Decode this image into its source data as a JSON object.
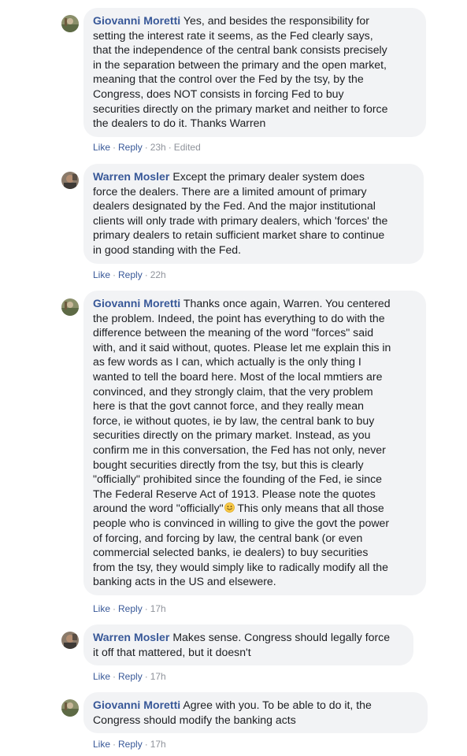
{
  "colors": {
    "author": "#385898",
    "bubble_bg": "#f2f3f5",
    "text": "#1c1e21",
    "meta": "#90949c"
  },
  "comments": [
    {
      "author": "Giovanni Moretti",
      "text": "Yes, and besides the responsibility for\nsetting the interest rate it seems, as the Fed clearly says,\nthat the independence of the central bank consists precisely\nin the separation between the primary and the open market,\nmeaning that the control over the Fed by the tsy, by the\nCongress, does NOT consists in forcing Fed to buy\nsecurities directly on the primary market and neither to force\nthe dealers to do it. Thanks Warren",
      "like": "Like",
      "reply": "Reply",
      "time": "23h",
      "edited": "Edited"
    },
    {
      "author": "Warren Mosler",
      "text": "Except the primary dealer system does\nforce the dealers. There are a limited amount of primary\ndealers designated by the Fed. And the major institutional\nclients will only trade with primary dealers, which 'forces' the\nprimary dealers to retain sufficient market share to continue\nin good standing with the Fed.",
      "like": "Like",
      "reply": "Reply",
      "time": "22h"
    },
    {
      "author": "Giovanni Moretti",
      "text": "Thanks once again, Warren. You centered\nthe problem. Indeed, the point has everything to do with the\ndifference between the meaning of the word \"forces\" said\nwith, and it said without, quotes. Please let me explain this in\nas few words as I can, which actually is the only thing I\nwanted to tell the board here. Most of the local mmtiers are\nconvinced, and they strongly claim, that the very problem\nhere is that the govt cannot force, and they really mean\nforce, ie without quotes, ie by law, the central bank to buy\nsecurities directly on the primary market. Instead, as you\nconfirm me in this conversation, the Fed has not only, never\nbought securities directly from the tsy, but this is clearly\n\"officially\" prohibited since the founding of the Fed, ie since\nThe Federal Reserve Act of 1913. Please note the quotes\naround the word \"officially\"",
      "text_after_emoji": " This only means that all those\npeople who is convinced in willing to give the govt the power\nof forcing, and forcing by law, the central bank (or even\ncommercial selected banks, ie dealers) to buy securities\nfrom the tsy, they would simply like to radically modify all the\nbanking acts in the US and elsewere.",
      "like": "Like",
      "reply": "Reply",
      "time": "17h"
    },
    {
      "author": "Warren Mosler",
      "text": "Makes sense. Congress should legally force\nit off that mattered, but it doesn't",
      "like": "Like",
      "reply": "Reply",
      "time": "17h"
    },
    {
      "author": "Giovanni Moretti",
      "text": "Agree with you. To be able to do it, the\nCongress should modify the banking acts",
      "like": "Like",
      "reply": "Reply",
      "time": "17h"
    }
  ]
}
